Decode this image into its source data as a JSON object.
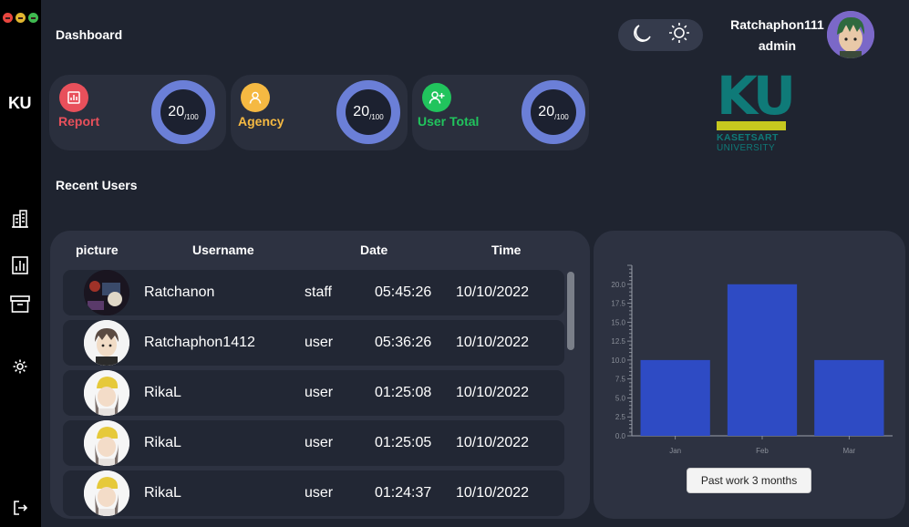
{
  "sidebar": {
    "brand": "KU",
    "icons": [
      "building-icon",
      "bar-chart-icon",
      "archive-icon",
      "gear-icon",
      "logout-icon"
    ]
  },
  "header": {
    "title": "Dashboard",
    "user_name": "Ratchaphon111",
    "user_role": "admin"
  },
  "stats": [
    {
      "label": "Report",
      "value": "20",
      "denominator": "100",
      "color": "#e8505b",
      "icon": "report-icon"
    },
    {
      "label": "Agency",
      "value": "20",
      "denominator": "100",
      "color": "#f5b942",
      "icon": "user-icon"
    },
    {
      "label": "User Total",
      "value": "20",
      "denominator": "100",
      "color": "#21c45d",
      "icon": "add-user-icon"
    }
  ],
  "logo": {
    "letters": "KU",
    "line1": "KASETSART",
    "line2": "UNIVERSITY"
  },
  "recent": {
    "title": "Recent Users",
    "columns": [
      "picture",
      "Username",
      "Date",
      "Time"
    ],
    "rows": [
      {
        "username": "Ratchanon",
        "role": "staff",
        "time": "05:45:26",
        "date": "10/10/2022"
      },
      {
        "username": "Ratchaphon1412",
        "role": "user",
        "time": "05:36:26",
        "date": "10/10/2022"
      },
      {
        "username": "RikaL",
        "role": "user",
        "time": "01:25:08",
        "date": "10/10/2022"
      },
      {
        "username": "RikaL",
        "role": "user",
        "time": "01:25:05",
        "date": "10/10/2022"
      },
      {
        "username": "RikaL",
        "role": "user",
        "time": "01:24:37",
        "date": "10/10/2022"
      }
    ]
  },
  "chart_data": {
    "type": "bar",
    "categories": [
      "Jan",
      "Feb",
      "Mar"
    ],
    "values": [
      10,
      20,
      10
    ],
    "ylim": [
      0,
      22.5
    ],
    "yticks": [
      "0.0",
      "2.5",
      "5.0",
      "7.5",
      "10.0",
      "12.5",
      "15.0",
      "17.5",
      "20.0"
    ],
    "bar_color": "#2e4bc4"
  },
  "chart_button": "Past work 3 months"
}
